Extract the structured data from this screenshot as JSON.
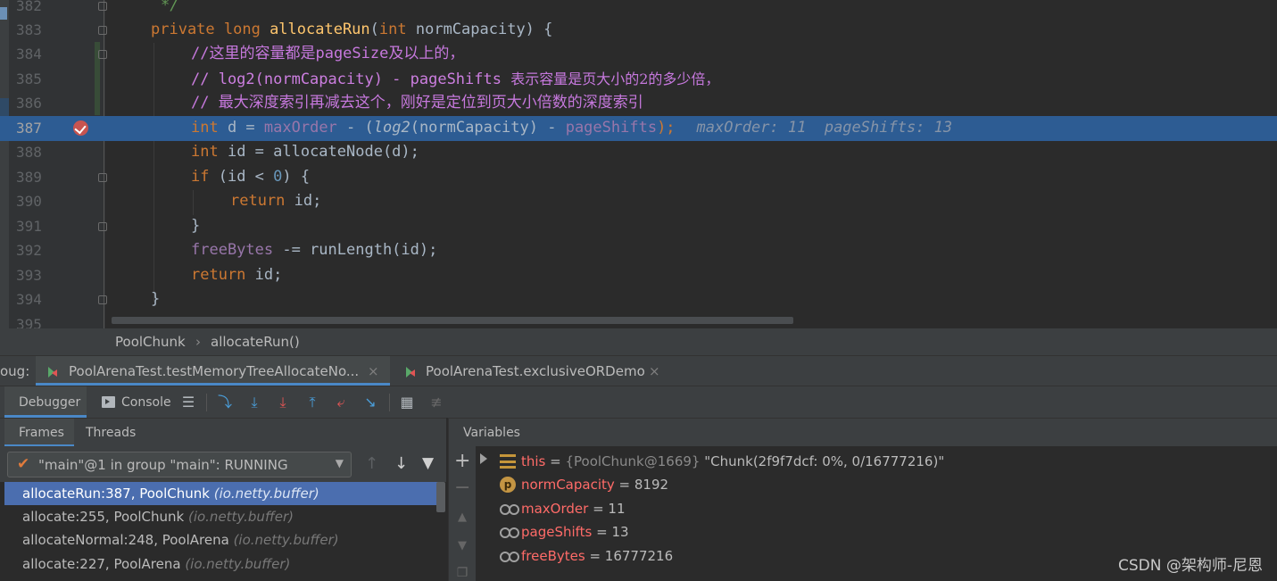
{
  "editor": {
    "lines": [
      {
        "num": "382"
      },
      {
        "num": "383"
      },
      {
        "num": "384"
      },
      {
        "num": "385"
      },
      {
        "num": "386"
      },
      {
        "num": "387"
      },
      {
        "num": "388"
      },
      {
        "num": "389"
      },
      {
        "num": "390"
      },
      {
        "num": "391"
      },
      {
        "num": "392"
      },
      {
        "num": "393"
      },
      {
        "num": "394"
      },
      {
        "num": "395"
      }
    ],
    "code": {
      "l382": "*/",
      "l383_kw": "private long ",
      "l383_fn": "allocateRun",
      "l383_p1": "(",
      "l383_kw2": "int",
      "l383_rest": " normCapacity) {",
      "l384": "//这里的容量都是pageSize及以上的，",
      "l385a": "// log2(normCapacity) - pageShifts ",
      "l385b": "表示容量是页大小的2的多少倍，",
      "l386": "// 最大深度索引再减去这个，刚好是定位到页大小倍数的深度索引",
      "l387_kw": "int",
      "l387_a": " d = ",
      "l387_f1": "maxOrder",
      "l387_b": " - (",
      "l387_i": "log2",
      "l387_c": "(normCapacity) - ",
      "l387_f2": "pageShifts",
      "l387_d": ");",
      "l387_inline": "maxOrder: 11  pageShifts: 13",
      "l388_kw": "int",
      "l388_rest": " id = allocateNode(d);",
      "l388_semi": "",
      "l389_kw": "if",
      "l389_a": " (id < ",
      "l389_num": "0",
      "l389_b": ") {",
      "l390_kw": "return",
      "l390_rest": " id;",
      "l391": "}",
      "l392_f": "freeBytes",
      "l392_rest": " -= runLength(id);",
      "l393_kw": "return",
      "l393_rest": " id;",
      "l394": "}"
    }
  },
  "breadcrumb": {
    "class_name": "PoolChunk",
    "separator": "›",
    "method": "allocateRun()"
  },
  "debug_tabs": {
    "label": "oug:",
    "tabs": [
      {
        "label": "PoolArenaTest.testMemoryTreeAllocateNo..."
      },
      {
        "label": "PoolArenaTest.exclusiveORDemo"
      }
    ],
    "close_glyph": "×"
  },
  "toolbar": {
    "debugger_label": "Debugger",
    "console_label": "Console"
  },
  "frames": {
    "tab_frames": "Frames",
    "tab_threads": "Threads",
    "thread_selector": "\"main\"@1 in group \"main\": RUNNING",
    "rows": [
      {
        "method": "allocateRun:387, PoolChunk ",
        "pkg": "(io.netty.buffer)"
      },
      {
        "method": "allocate:255, PoolChunk ",
        "pkg": "(io.netty.buffer)"
      },
      {
        "method": "allocateNormal:248, PoolArena ",
        "pkg": "(io.netty.buffer)"
      },
      {
        "method": "allocate:227, PoolArena ",
        "pkg": "(io.netty.buffer)"
      }
    ]
  },
  "variables": {
    "header": "Variables",
    "rows": [
      {
        "name": "this",
        "eq": " = ",
        "type": "{PoolChunk@1669} ",
        "value": "\"Chunk(2f9f7dcf: 0%, 0/16777216)\"",
        "icon": "object-icon"
      },
      {
        "name": "normCapacity",
        "eq": " = ",
        "type": "",
        "value": "8192",
        "icon": "parameter-icon"
      },
      {
        "name": "maxOrder",
        "eq": " = ",
        "type": "",
        "value": "11",
        "icon": "watch-icon"
      },
      {
        "name": "pageShifts",
        "eq": " = ",
        "type": "",
        "value": "13",
        "icon": "watch-icon"
      },
      {
        "name": "freeBytes",
        "eq": " = ",
        "type": "",
        "value": "16777216",
        "icon": "watch-icon"
      }
    ]
  },
  "watermark": "CSDN @架构师-尼恩",
  "colors": {
    "accent": "#4a88c7",
    "current_line": "#2d5c93",
    "selected_frame": "#4b6eaf",
    "breakpoint": "#c75450"
  }
}
